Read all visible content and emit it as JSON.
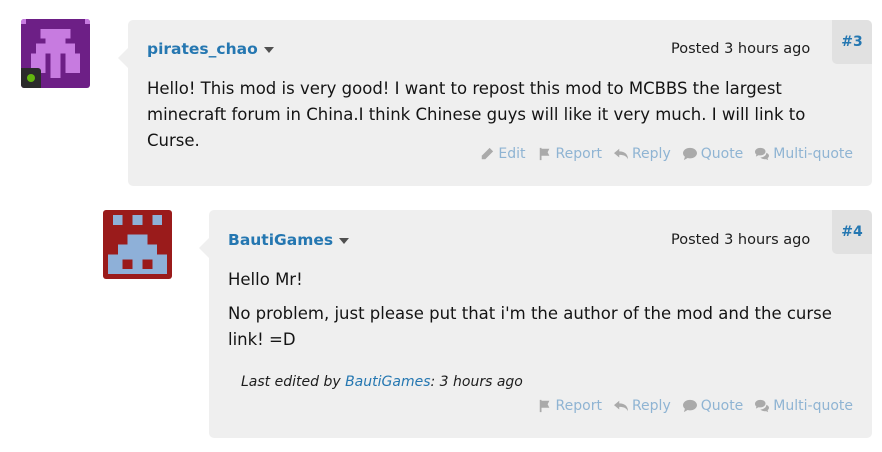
{
  "posts": [
    {
      "username": "pirates_chao",
      "posted_label": "Posted",
      "time": "3 hours ago",
      "number": "#3",
      "body": [
        "Hello! This mod is very good! I want to repost this mod to MCBBS the largest minecraft forum in China.I think Chinese guys will like it very much. I will link to Curse."
      ],
      "actions": [
        "Edit",
        "Report",
        "Reply",
        "Quote",
        "Multi-quote"
      ],
      "avatar_color": "#6d1f86",
      "online": true
    },
    {
      "username": "BautiGames",
      "posted_label": "Posted",
      "time": "3 hours ago",
      "number": "#4",
      "body": [
        "Hello Mr!",
        "No problem, just please put that i'm the author of the mod and the curse link! =D"
      ],
      "edited": {
        "prefix": "Last edited by",
        "editor": "BautiGames",
        "suffix": ": 3 hours ago"
      },
      "actions": [
        "Report",
        "Reply",
        "Quote",
        "Multi-quote"
      ],
      "avatar_color": "#9a1b1b"
    }
  ],
  "colors": {
    "link": "#2577b1",
    "action": "#8fb4d3",
    "post_bg": "#efefef",
    "num_bg": "#e1e1e1"
  },
  "icons": {
    "edit": "pencil-icon",
    "report": "flag-icon",
    "reply": "reply-arrow-icon",
    "quote": "speech-bubble-icon",
    "multi_quote": "double-speech-bubble-icon"
  }
}
